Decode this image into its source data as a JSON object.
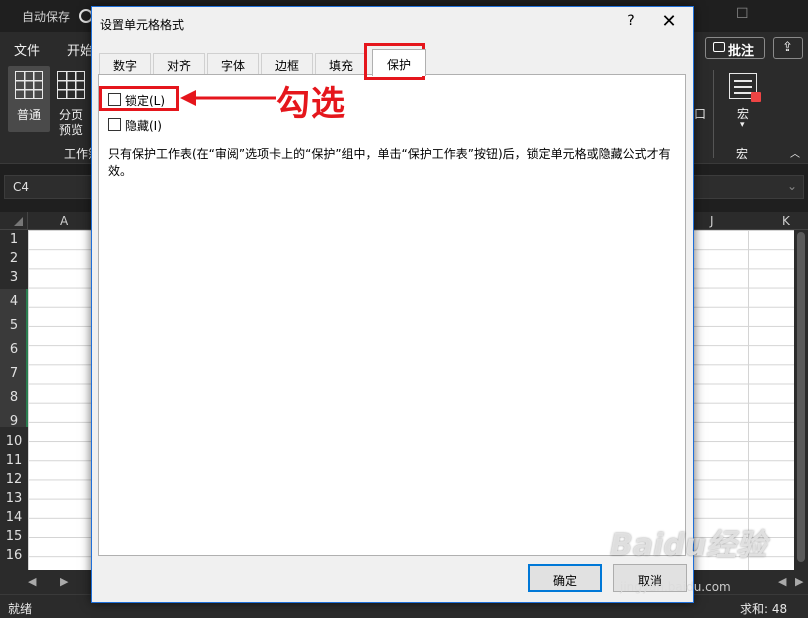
{
  "excel": {
    "autosave_label": "自动保存",
    "menu": {
      "file": "文件",
      "home": "开始"
    },
    "comment_button": "批注",
    "view_normal_label": "普通",
    "view_pagebreak_label_1": "分页",
    "view_pagebreak_label_2": "预览",
    "workbook_group_label": "工作簿",
    "macro_label": "宏",
    "macro_group_label": "宏",
    "right_edge_char": "口",
    "name_box": "C4",
    "columns": [
      "A",
      "J",
      "K"
    ],
    "rows": [
      "1",
      "2",
      "3",
      "4",
      "5",
      "6",
      "7",
      "8",
      "9",
      "10",
      "11",
      "12",
      "13",
      "14",
      "15",
      "16"
    ],
    "status_ready": "就绪",
    "status_sum": "求和: 48"
  },
  "dialog": {
    "title": "设置单元格格式",
    "help": "?",
    "close": "✕",
    "tabs": [
      "数字",
      "对齐",
      "字体",
      "边框",
      "填充",
      "保护"
    ],
    "active_tab": "保护",
    "locked_label": "锁定(L)",
    "hidden_label": "隐藏(I)",
    "locked_checked": false,
    "hidden_checked": false,
    "description": "只有保护工作表(在“审阅”选项卡上的“保护”组中，单击“保护工作表”按钮)后，锁定单元格或隐藏公式才有效。",
    "ok_label": "确定",
    "cancel_label": "取消"
  },
  "annotation": {
    "text": "勾选",
    "color": "#e5161c"
  },
  "watermark": {
    "main": "Baidu经验",
    "sub": "jingyan.baidu.com"
  }
}
